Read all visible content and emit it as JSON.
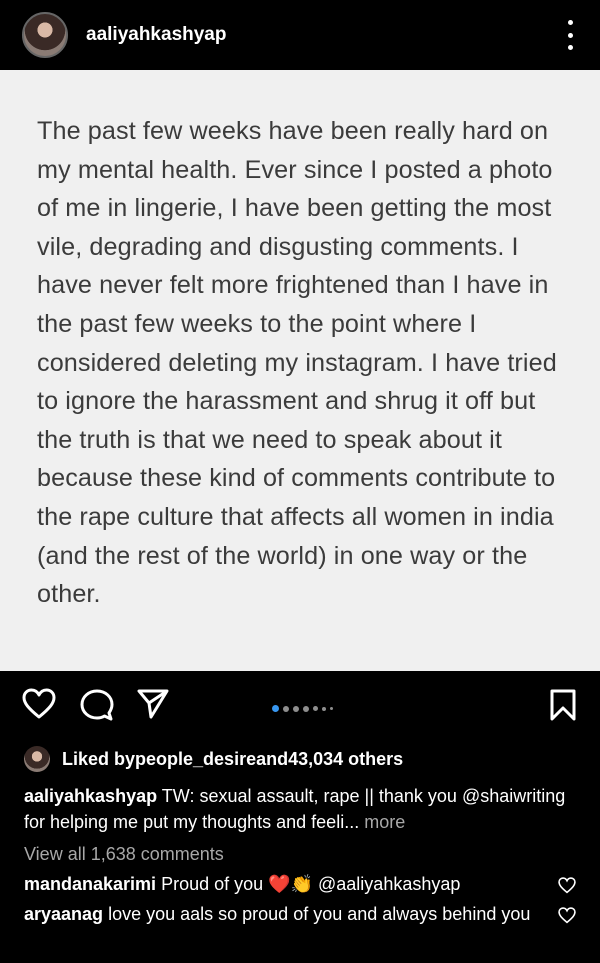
{
  "post": {
    "username": "aaliyahkashyap",
    "image_text": "The past few weeks have been really hard on my mental health. Ever since I posted a photo of me in lingerie, I have been getting the most vile, degrading and disgusting comments. I have never felt more frightened than I have in the past few weeks to the point where I considered deleting my instagram. I have tried to ignore the harassment and shrug it off but the truth is that we need to speak about it because these kind of comments contribute to the rape culture that affects all women in india (and the rest of the world) in one way or the other."
  },
  "likes": {
    "prefix": "Liked by ",
    "user": "people_desire",
    "middle": " and ",
    "count": "43,034 others"
  },
  "caption": {
    "user": "aaliyahkashyap",
    "text": "TW: sexual assault, rape || thank you @shaiwriting for helping me put my thoughts and feeli...",
    "more": "more"
  },
  "view_all": "View all 1,638 comments",
  "comments": [
    {
      "user": "mandanakarimi",
      "text": "Proud of you",
      "emoji": "❤️👏",
      "mention": "@aaliyahkashyap"
    },
    {
      "user": "aryaanag",
      "text": "love you aals so proud of you and always behind you"
    }
  ],
  "colors": {
    "background": "#000000",
    "image_bg": "#f0f0f0",
    "muted": "#a8a8a8"
  },
  "icons": [
    "more-vertical-icon",
    "heart-icon",
    "comment-icon",
    "share-icon",
    "bookmark-icon"
  ]
}
